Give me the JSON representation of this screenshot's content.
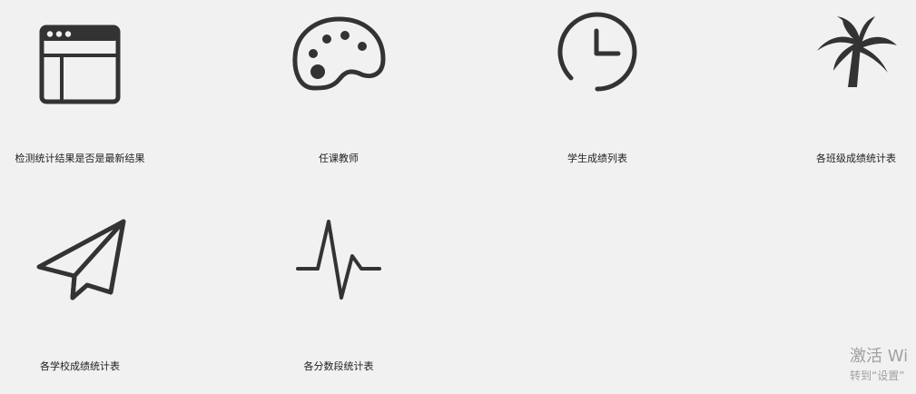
{
  "tiles": [
    {
      "label": "检测统计结果是否是最新结果",
      "icon": "browser-window-icon"
    },
    {
      "label": "任课教师",
      "icon": "palette-icon"
    },
    {
      "label": "学生成绩列表",
      "icon": "clock-icon"
    },
    {
      "label": "各班级成绩统计表",
      "icon": "palm-tree-icon"
    },
    {
      "label": "各学校成绩统计表",
      "icon": "paper-plane-icon"
    },
    {
      "label": "各分数段统计表",
      "icon": "pulse-icon"
    }
  ],
  "watermark": {
    "line1": "激活 Wi",
    "line2": "转到“设置”"
  },
  "colors": {
    "background": "#f1f1f1",
    "icon": "#333333",
    "text": "#222222",
    "watermark": "#a0a0a0"
  }
}
